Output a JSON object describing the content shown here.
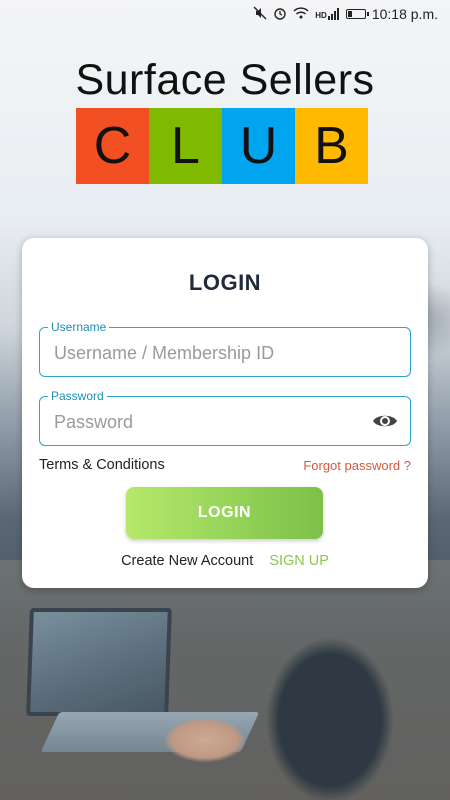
{
  "status_bar": {
    "time": "10:18 p.m.",
    "icons": [
      "mute-icon",
      "alarm-icon",
      "wifi-icon",
      "hd-signal-icon",
      "battery-icon"
    ],
    "hd_label": "HD"
  },
  "logo": {
    "title": "Surface Sellers",
    "letters": [
      "C",
      "L",
      "U",
      "B"
    ],
    "colors": [
      "#f25022",
      "#7fba00",
      "#00a4ef",
      "#ffb900"
    ]
  },
  "login_card": {
    "title": "LOGIN",
    "username": {
      "label": "Username",
      "placeholder": "Username / Membership ID",
      "value": ""
    },
    "password": {
      "label": "Password",
      "placeholder": "Password",
      "value": "",
      "toggle_icon": "eye-icon"
    },
    "terms_link": "Terms & Conditions",
    "forgot_link": "Forgot password ?",
    "login_button": "LOGIN",
    "create_account_text": "Create New Account",
    "signup_link": "SIGN UP"
  },
  "colors": {
    "accent": "#29a6c9",
    "forgot": "#d05a3c",
    "signup": "#8cc84b",
    "button_start": "#b6e86a",
    "button_end": "#7ec04a"
  }
}
